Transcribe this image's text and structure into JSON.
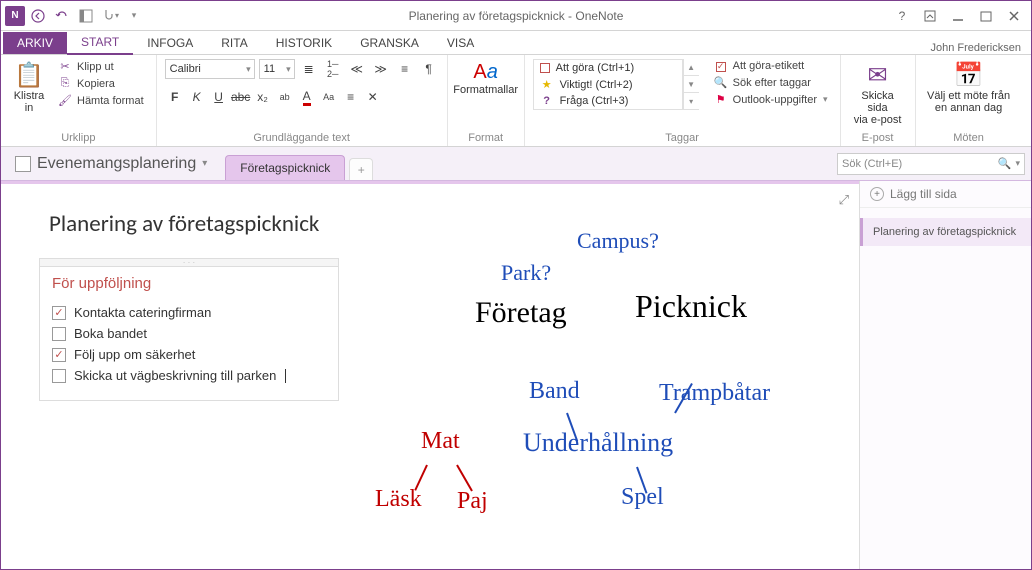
{
  "app": {
    "title": "Planering av företagspicknick - OneNote"
  },
  "user": {
    "name": "John Fredericksen"
  },
  "tabs": {
    "file": "ARKIV",
    "items": [
      "START",
      "INFOGA",
      "RITA",
      "HISTORIK",
      "GRANSKA",
      "VISA"
    ],
    "active": 0
  },
  "ribbon": {
    "clipboard": {
      "label": "Urklipp",
      "paste": "Klistra\nin",
      "cut": "Klipp ut",
      "copy": "Kopiera",
      "painter": "Hämta format"
    },
    "font": {
      "label": "Grundläggande text",
      "name": "Calibri",
      "size": "11"
    },
    "format": {
      "label": "Format",
      "styles": "Formatmallar"
    },
    "tags": {
      "label": "Taggar",
      "rows": [
        {
          "ic": "☐",
          "color": "#c0504d",
          "txt": "Att göra (Ctrl+1)"
        },
        {
          "ic": "★",
          "color": "#e6b800",
          "txt": "Viktigt! (Ctrl+2)"
        },
        {
          "ic": "?",
          "color": "#7b3f8c",
          "txt": "Fråga (Ctrl+3)"
        }
      ],
      "todo_label": "Att göra-etikett",
      "find": "Sök efter taggar",
      "outlook": "Outlook-uppgifter"
    },
    "email": {
      "label": "E-post",
      "btn": "Skicka sida\nvia e-post"
    },
    "meetings": {
      "label": "Möten",
      "btn": "Välj ett möte från\nen annan dag"
    }
  },
  "notebook": {
    "name": "Evenemangsplanering",
    "section": "Företagspicknick"
  },
  "search": {
    "placeholder": "Sök (Ctrl+E)"
  },
  "page": {
    "title": "Planering av företagspicknick",
    "note": {
      "title": "För uppföljning",
      "items": [
        {
          "checked": true,
          "txt": "Kontakta cateringfirman"
        },
        {
          "checked": false,
          "txt": "Boka bandet"
        },
        {
          "checked": true,
          "txt": "Följ upp om säkerhet"
        },
        {
          "checked": false,
          "txt": "Skicka ut vägbeskrivning till parken"
        }
      ]
    },
    "ink": {
      "campus": "Campus?",
      "park": "Park?",
      "foretag": "Företag",
      "picknick": "Picknick",
      "band": "Band",
      "trampbatar": "Trampbåtar",
      "underhallning": "Underhållning",
      "spel": "Spel",
      "mat": "Mat",
      "lask": "Läsk",
      "paj": "Paj"
    }
  },
  "pagelist": {
    "add": "Lägg till sida",
    "current": "Planering av företagspicknick"
  }
}
